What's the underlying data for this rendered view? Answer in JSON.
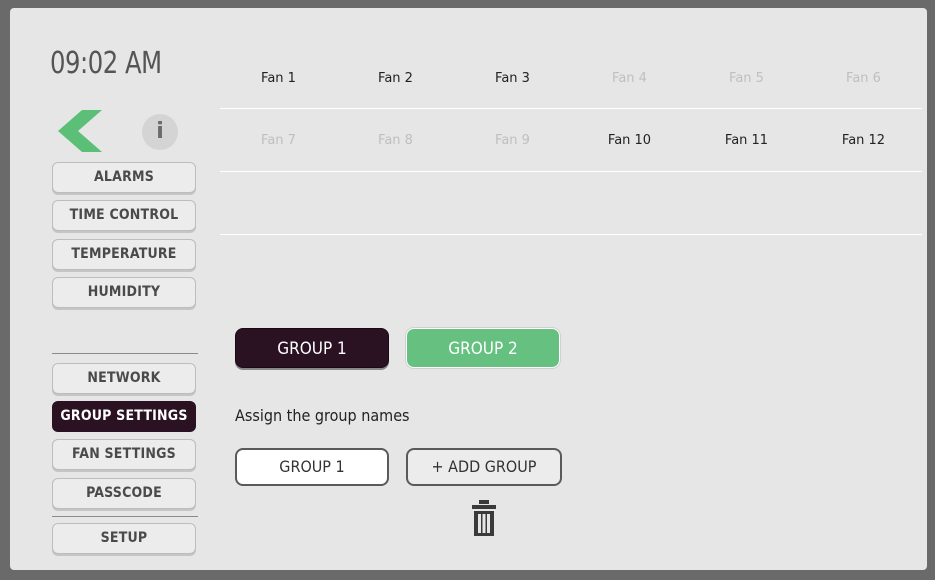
{
  "clock": "09:02 AM",
  "info_label": "i",
  "nav_top": [
    {
      "label": "ALARMS"
    },
    {
      "label": "TIME CONTROL"
    },
    {
      "label": "TEMPERATURE"
    },
    {
      "label": "HUMIDITY"
    }
  ],
  "nav_bottom": [
    {
      "label": "NETWORK"
    },
    {
      "label": "GROUP SETTINGS",
      "active": true
    },
    {
      "label": "FAN SETTINGS"
    },
    {
      "label": "PASSCODE"
    }
  ],
  "setup_label": "SETUP",
  "fans_row1": [
    {
      "label": "Fan 1",
      "enabled": true
    },
    {
      "label": "Fan 2",
      "enabled": true
    },
    {
      "label": "Fan 3",
      "enabled": true
    },
    {
      "label": "Fan 4",
      "enabled": false
    },
    {
      "label": "Fan 5",
      "enabled": false
    },
    {
      "label": "Fan 6",
      "enabled": false
    }
  ],
  "fans_row2": [
    {
      "label": "Fan 7",
      "enabled": false
    },
    {
      "label": "Fan 8",
      "enabled": false
    },
    {
      "label": "Fan 9",
      "enabled": false
    },
    {
      "label": "Fan 10",
      "enabled": true
    },
    {
      "label": "Fan 11",
      "enabled": true
    },
    {
      "label": "Fan 12",
      "enabled": true
    }
  ],
  "group_tabs": [
    {
      "label": "GROUP 1",
      "selected": true
    },
    {
      "label": "GROUP 2",
      "selected": false
    }
  ],
  "assign_text": "Assign the group names",
  "group_name_value": "GROUP 1",
  "add_group_label": "+ ADD GROUP",
  "icons": {
    "back": "back-arrow-icon",
    "info": "info-icon",
    "delete": "trash-icon"
  },
  "colors": {
    "dark_accent": "#2b1222",
    "green_accent": "#66c181",
    "back_arrow": "#5cbf78"
  }
}
